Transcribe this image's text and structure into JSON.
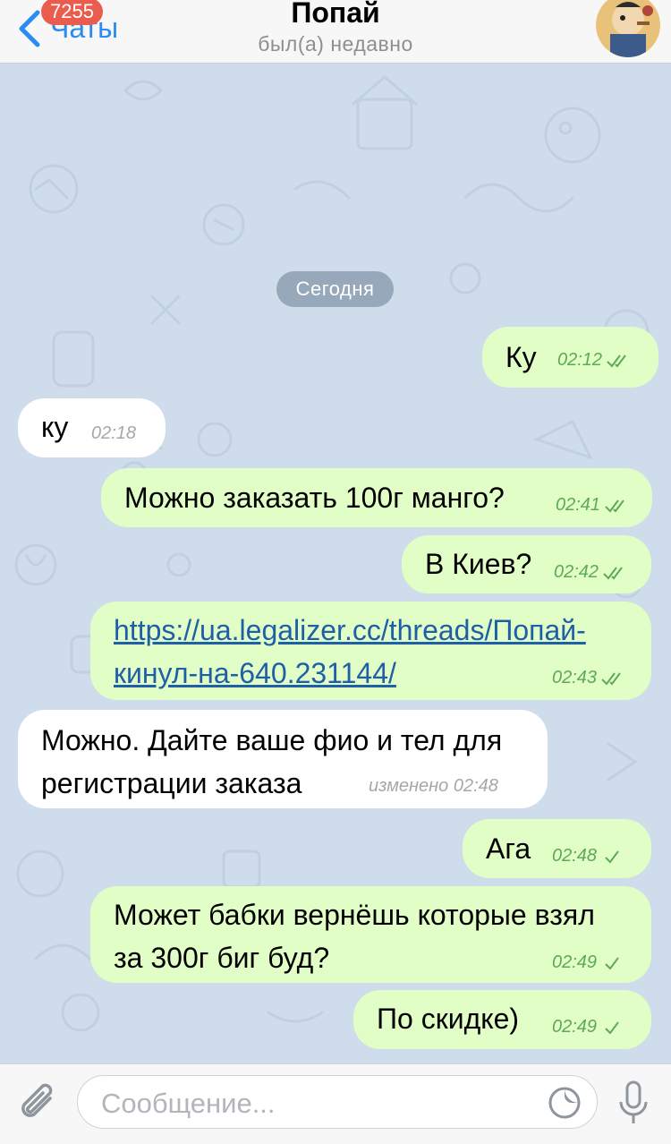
{
  "header": {
    "unread_badge": "7255",
    "back_label": "Чаты",
    "title": "Попай",
    "subtitle": "был(а) недавно"
  },
  "chat": {
    "date_separator": "Сегодня",
    "messages": [
      {
        "direction": "out",
        "text": "Ку",
        "time": "02:12",
        "status": "read"
      },
      {
        "direction": "in",
        "text": "ку",
        "time": "02:18"
      },
      {
        "direction": "out",
        "text": "Можно заказать 100г манго?",
        "time": "02:41",
        "status": "read"
      },
      {
        "direction": "out",
        "text": "В Киев?",
        "time": "02:42",
        "status": "read"
      },
      {
        "direction": "out",
        "text_lines": [
          "https://ua.legalizer.cc/threads/Попай-",
          "кинул-на-640.231144/"
        ],
        "is_link": true,
        "time": "02:43",
        "status": "read"
      },
      {
        "direction": "in",
        "text_lines": [
          "Можно. Дайте ваше фио и тел для",
          "регистрации заказа"
        ],
        "edited_label": "изменено",
        "time": "02:48"
      },
      {
        "direction": "out",
        "text": "Ага",
        "time": "02:48",
        "status": "sent"
      },
      {
        "direction": "out",
        "text_lines": [
          "Может бабки вернёшь которые взял",
          "за 300г биг буд?"
        ],
        "time": "02:49",
        "status": "sent"
      },
      {
        "direction": "out",
        "text": "По скидке)",
        "time": "02:49",
        "status": "sent"
      }
    ]
  },
  "input": {
    "placeholder": "Сообщение...",
    "value": ""
  },
  "icons": {
    "back": "chevron-left-icon",
    "attach": "paperclip-icon",
    "sticker": "sticker-icon",
    "mic": "microphone-icon",
    "read": "double-check-icon",
    "sent": "single-check-icon"
  },
  "colors": {
    "accent": "#2a8cf2",
    "badge": "#ea5d4e",
    "outgoing_bubble": "#e1fec6",
    "incoming_bubble": "#ffffff",
    "outgoing_meta": "#5fa956",
    "link": "#1f5fa8",
    "wallpaper": "#cfdceb"
  }
}
